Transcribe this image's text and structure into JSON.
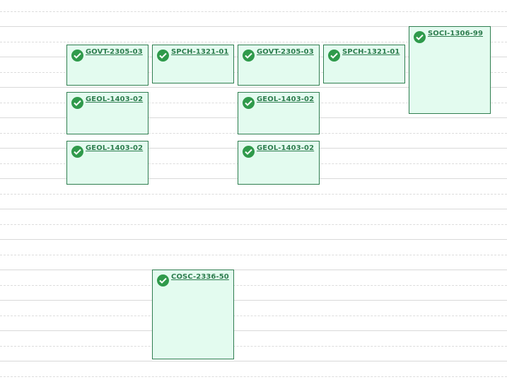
{
  "courses": [
    {
      "code": "GOVT-2305-03",
      "status_icon": "check-circle-icon"
    },
    {
      "code": "SPCH-1321-01",
      "status_icon": "check-circle-icon"
    },
    {
      "code": "GOVT-2305-03",
      "status_icon": "check-circle-icon"
    },
    {
      "code": "SPCH-1321-01",
      "status_icon": "check-circle-icon"
    },
    {
      "code": "SOCI-1306-99",
      "status_icon": "check-circle-icon"
    },
    {
      "code": "GEOL-1403-02",
      "status_icon": "check-circle-icon"
    },
    {
      "code": "GEOL-1403-02",
      "status_icon": "check-circle-icon"
    },
    {
      "code": "GEOL-1403-02",
      "status_icon": "check-circle-icon"
    },
    {
      "code": "GEOL-1403-02",
      "status_icon": "check-circle-icon"
    },
    {
      "code": "COSC-2336-50",
      "status_icon": "check-circle-icon"
    }
  ],
  "colors": {
    "block_fill": "#e3fbef",
    "block_border": "#2e7d4f",
    "check": "#2f9a4b",
    "link": "#2e7d4f"
  }
}
